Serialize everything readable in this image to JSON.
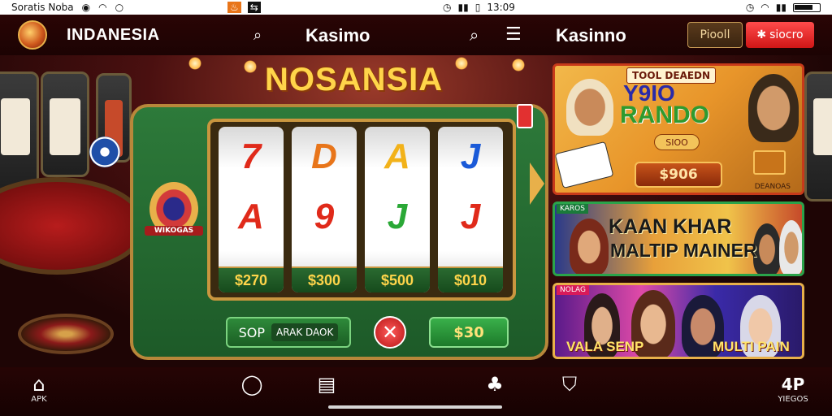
{
  "status_bar": {
    "left_text": "Soratis Noba",
    "right_text": "13:09"
  },
  "header": {
    "brand": "INDANESIA",
    "title_center": "Kasimo",
    "title_right": "Kasinno",
    "login_label": "Piooll",
    "register_label": "siocro",
    "icons": [
      "search-icon",
      "search-icon",
      "menu-icon",
      "star-icon"
    ]
  },
  "slot": {
    "title": "NOSANSIA",
    "badge_label": "WIKOGAS",
    "reels": [
      {
        "top": "7",
        "bottom": "A",
        "value": "$270",
        "top_color": "#e02a1a",
        "bottom_color": "#e02a1a"
      },
      {
        "top": "D",
        "bottom": "9",
        "value": "$300",
        "top_color": "#e8751a",
        "bottom_color": "#e02a1a"
      },
      {
        "top": "A",
        "bottom": "J",
        "value": "$500",
        "top_color": "#f2b21a",
        "bottom_color": "#2aa836"
      },
      {
        "top": "J",
        "bottom": "J",
        "value": "$010",
        "top_color": "#1a5ad8",
        "bottom_color": "#e02a1a"
      }
    ],
    "stop_label": "SOP",
    "stop_sub": "ARAK DAOK",
    "cancel_label": "✕",
    "spin_label": "$30"
  },
  "promos": [
    {
      "tag": "TOOL DEAEDN",
      "title_line1": "Y9IO",
      "title_line2": "RANDO",
      "pill": "SIOO",
      "button": "$906",
      "footer": "DEANOAS"
    },
    {
      "tag": "KAROS",
      "line1": "KAAN KHAR",
      "line2": "MALTIP MAINER"
    },
    {
      "tag": "NOLAG",
      "left": "VALA SENP",
      "right": "MULTI PAIN"
    }
  ],
  "bottom_nav": [
    {
      "icon": "home-icon",
      "glyph": "⌂",
      "label": "APK"
    },
    {
      "icon": "profile-icon",
      "glyph": "◯",
      "label": ""
    },
    {
      "icon": "list-icon",
      "glyph": "▤",
      "label": ""
    },
    {
      "icon": "club-icon",
      "glyph": "♣",
      "label": ""
    },
    {
      "icon": "bag-icon",
      "glyph": "⛉",
      "label": ""
    },
    {
      "icon": "4pk-icon",
      "glyph": "4P",
      "label": "YIEGOS"
    }
  ],
  "colors": {
    "background": "#1a0606",
    "accent_gold": "#ffd54a",
    "accent_red": "#e23030",
    "accent_green": "#2d7a3a"
  }
}
